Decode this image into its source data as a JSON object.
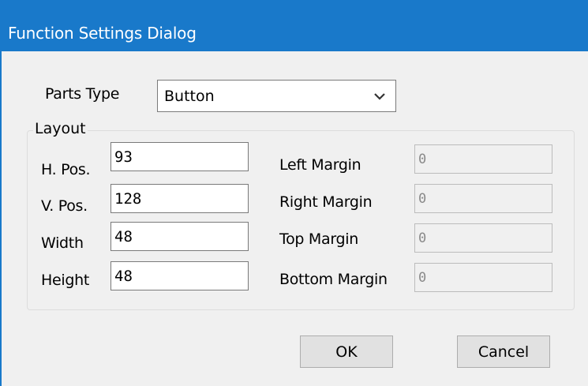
{
  "window": {
    "title": "Function Settings Dialog"
  },
  "parts_type": {
    "label": "Parts Type",
    "value": "Button"
  },
  "layout": {
    "group_label": "Layout",
    "h_pos": {
      "label": "H. Pos.",
      "value": "93"
    },
    "v_pos": {
      "label": "V. Pos.",
      "value": "128"
    },
    "width": {
      "label": "Width",
      "value": "48"
    },
    "height": {
      "label": "Height",
      "value": "48"
    },
    "left_margin": {
      "label": "Left Margin",
      "value": "0"
    },
    "right_margin": {
      "label": "Right Margin",
      "value": "0"
    },
    "top_margin": {
      "label": "Top Margin",
      "value": "0"
    },
    "bottom_margin": {
      "label": "Bottom Margin",
      "value": "0"
    }
  },
  "buttons": {
    "ok": "OK",
    "cancel": "Cancel"
  },
  "colors": {
    "titlebar": "#1979ca",
    "dialog_bg": "#f0f0f0"
  },
  "icons": {
    "dropdown": "chevron-down-icon"
  }
}
